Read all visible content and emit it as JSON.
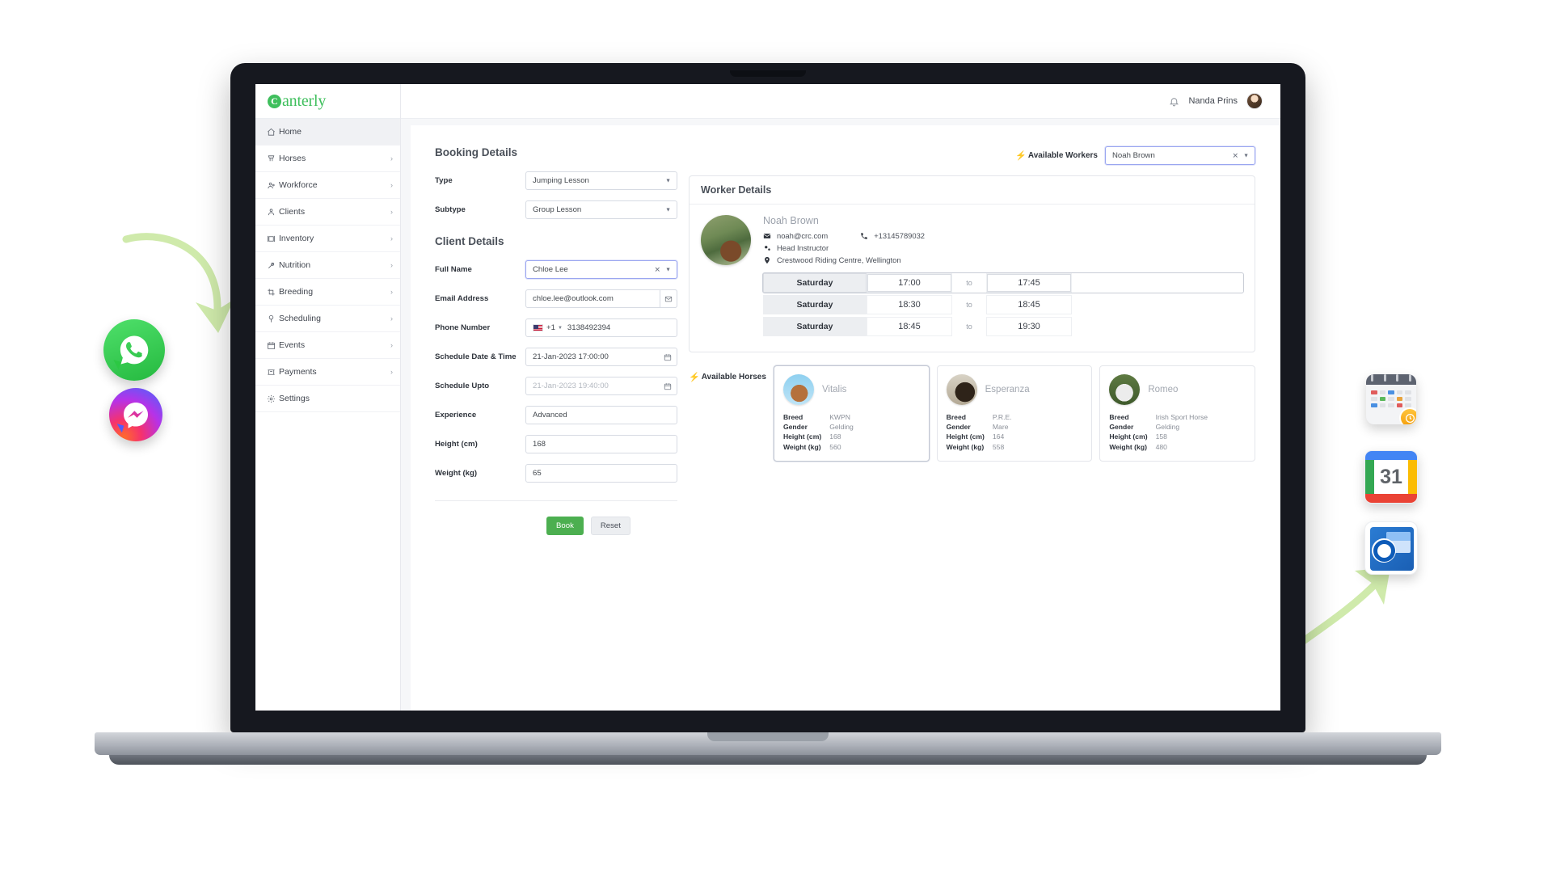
{
  "app": {
    "logo_mark": "C",
    "logo_text": "anterly"
  },
  "topbar": {
    "bell_icon": "bell-icon",
    "user_name": "Nanda Prins",
    "avatar": "user-avatar"
  },
  "sidebar": {
    "items": [
      {
        "label": "Home",
        "icon": "home-icon",
        "chevron": "",
        "active": true
      },
      {
        "label": "Horses",
        "icon": "horse-icon",
        "chevron": "›",
        "active": false
      },
      {
        "label": "Workforce",
        "icon": "workforce-icon",
        "chevron": "›",
        "active": false
      },
      {
        "label": "Clients",
        "icon": "clients-icon",
        "chevron": "›",
        "active": false
      },
      {
        "label": "Inventory",
        "icon": "inventory-icon",
        "chevron": "›",
        "active": false
      },
      {
        "label": "Nutrition",
        "icon": "nutrition-icon",
        "chevron": "›",
        "active": false
      },
      {
        "label": "Breeding",
        "icon": "breeding-icon",
        "chevron": "›",
        "active": false
      },
      {
        "label": "Scheduling",
        "icon": "scheduling-icon",
        "chevron": "›",
        "active": false
      },
      {
        "label": "Events",
        "icon": "events-icon",
        "chevron": "›",
        "active": false
      },
      {
        "label": "Payments",
        "icon": "payments-icon",
        "chevron": "›",
        "active": false
      },
      {
        "label": "Settings",
        "icon": "settings-icon",
        "chevron": "",
        "active": false
      }
    ]
  },
  "booking": {
    "section_title": "Booking Details",
    "type_label": "Type",
    "type_value": "Jumping Lesson",
    "subtype_label": "Subtype",
    "subtype_value": "Group Lesson"
  },
  "client": {
    "section_title": "Client Details",
    "full_name_label": "Full Name",
    "full_name_value": "Chloe Lee",
    "email_label": "Email Address",
    "email_value": "chloe.lee@outlook.com",
    "phone_label": "Phone Number",
    "phone_dial_code": "+1",
    "phone_value": "3138492394",
    "phone_flag": "us-flag-icon",
    "schedule_from_label": "Schedule Date & Time",
    "schedule_from_value": "21-Jan-2023 17:00:00",
    "schedule_upto_label": "Schedule Upto",
    "schedule_upto_value": "21-Jan-2023 19:40:00",
    "experience_label": "Experience",
    "experience_value": "Advanced",
    "height_label": "Height (cm)",
    "height_value": "168",
    "weight_label": "Weight (kg)",
    "weight_value": "65"
  },
  "actions": {
    "book_label": "Book",
    "reset_label": "Reset"
  },
  "workers": {
    "available_label": "Available Workers",
    "selected": "Noah Brown",
    "clear_icon": "clear-x-icon",
    "dropdown_icon": "chevron-down-icon",
    "card_title": "Worker Details",
    "name": "Noah Brown",
    "email": "noah@crc.com",
    "phone": "+13145789032",
    "role": "Head Instructor",
    "location": "Crestwood Riding Centre, Wellington",
    "slot_separator": "to",
    "slots": [
      {
        "day": "Saturday",
        "from": "17:00",
        "to": "17:45",
        "selected": true
      },
      {
        "day": "Saturday",
        "from": "18:30",
        "to": "18:45",
        "selected": false
      },
      {
        "day": "Saturday",
        "from": "18:45",
        "to": "19:30",
        "selected": false
      }
    ]
  },
  "horses": {
    "available_label": "Available Horses",
    "spec_labels": {
      "breed": "Breed",
      "gender": "Gender",
      "height": "Height (cm)",
      "weight": "Weight (kg)"
    },
    "cards": [
      {
        "name": "Vitalis",
        "breed": "KWPN",
        "gender": "Gelding",
        "height": "168",
        "weight": "560",
        "selected": true
      },
      {
        "name": "Esperanza",
        "breed": "P.R.E.",
        "gender": "Mare",
        "height": "164",
        "weight": "558",
        "selected": false
      },
      {
        "name": "Romeo",
        "breed": "Irish Sport Horse",
        "gender": "Gelding",
        "height": "158",
        "weight": "480",
        "selected": false
      }
    ]
  },
  "floating_icons": {
    "whatsapp": "whatsapp-icon",
    "messenger": "messenger-icon",
    "calendar": "calendar-app-icon",
    "google_calendar": "google-calendar-icon",
    "google_calendar_day": "31",
    "outlook": "outlook-icon",
    "arrow_left": "curved-arrow-icon",
    "arrow_right": "curved-arrow-icon"
  },
  "colors": {
    "brand_green": "#3fbf5d",
    "book_button": "#4caf50",
    "accent_focus": "#9aa6f0",
    "bolt_yellow": "#f5b731"
  }
}
